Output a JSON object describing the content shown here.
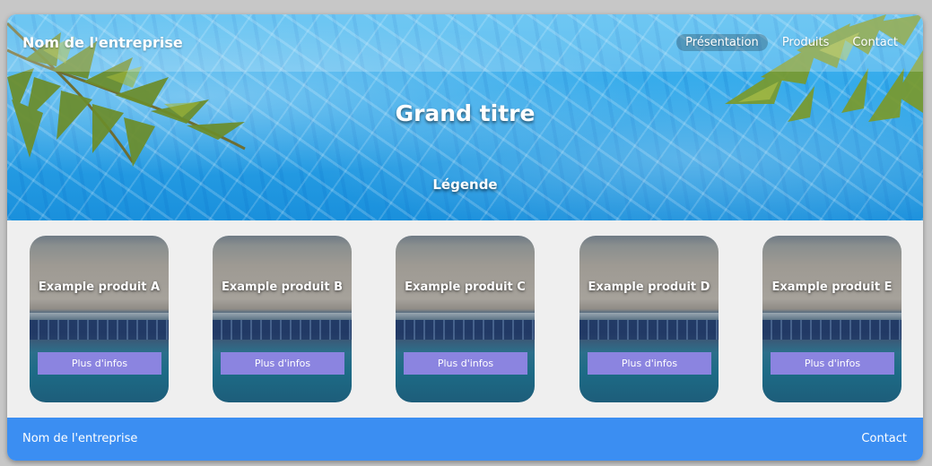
{
  "header": {
    "brand": "Nom de l'entreprise",
    "nav": [
      {
        "label": "Présentation",
        "active": true
      },
      {
        "label": "Produits",
        "active": false
      },
      {
        "label": "Contact",
        "active": false
      }
    ]
  },
  "hero": {
    "title": "Grand titre",
    "caption": "Légende",
    "background": "pool-water-image"
  },
  "products": [
    {
      "title": "Example produit A",
      "button": "Plus d'infos"
    },
    {
      "title": "Example produit B",
      "button": "Plus d'infos"
    },
    {
      "title": "Example produit C",
      "button": "Plus d'infos"
    },
    {
      "title": "Example produit D",
      "button": "Plus d'infos"
    },
    {
      "title": "Example produit E",
      "button": "Plus d'infos"
    }
  ],
  "footer": {
    "brand": "Nom de l'entreprise",
    "contact": "Contact"
  },
  "colors": {
    "footer": "#3b8ef2",
    "button": "#8b84e0",
    "page_bg": "#efefef"
  }
}
